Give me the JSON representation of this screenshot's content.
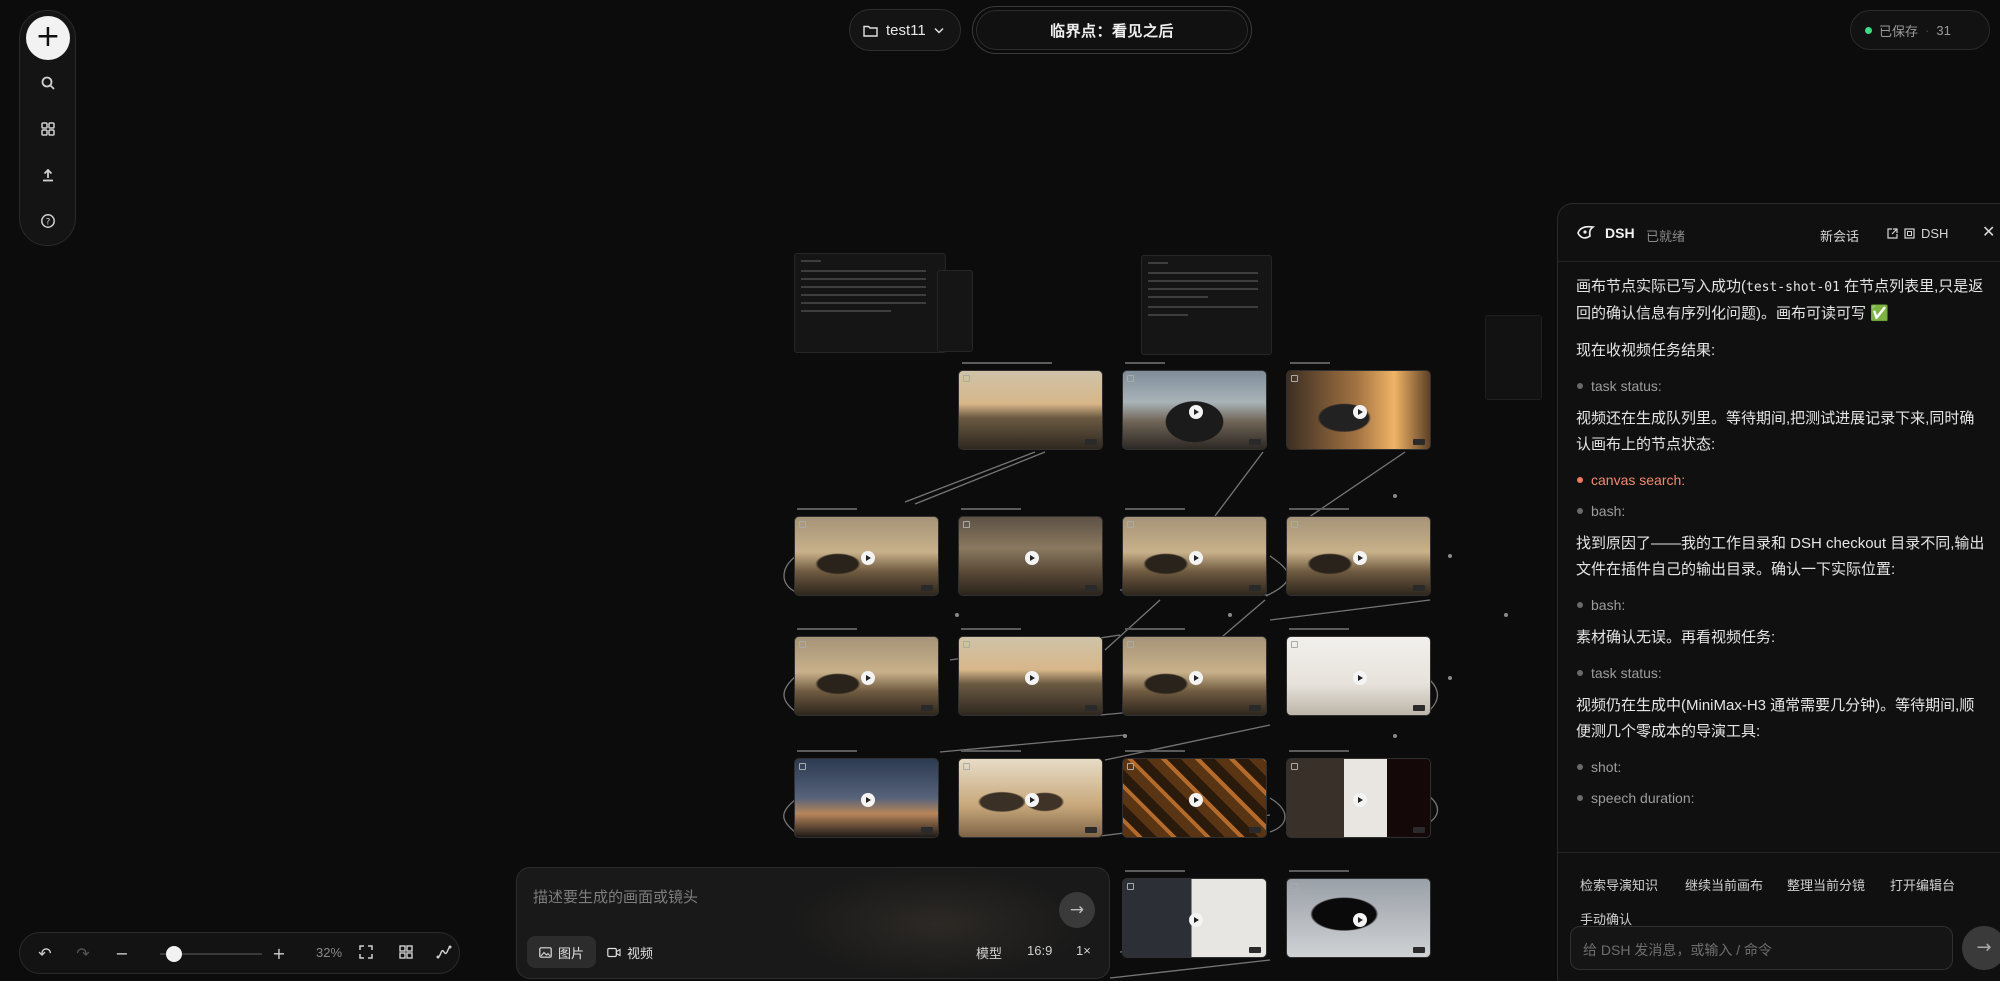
{
  "toolbar": {
    "add_icon": "plus-icon",
    "items": [
      "search-icon",
      "grid-icon",
      "upload-icon",
      "help-icon"
    ]
  },
  "project": {
    "name": "test11",
    "icon": "folder-icon"
  },
  "document_title": "临界点：看见之后",
  "save_status": {
    "label": "已保存",
    "count": "31",
    "color": "#3ddc84"
  },
  "zoom": {
    "level": "32%",
    "icons": [
      "undo-icon",
      "redo-icon",
      "zoom-out-icon",
      "zoom-in-icon",
      "fit-icon",
      "grid-toggle-icon",
      "link-icon"
    ]
  },
  "composer": {
    "placeholder": "描述要生成的画面或镜头",
    "mode_image": "图片",
    "mode_video": "视频",
    "model_label": "模型",
    "aspect": "16:9",
    "count": "1×"
  },
  "chat": {
    "brand": "DSH",
    "status": "已就绪",
    "new_chat": "新会话",
    "export": "DSH",
    "messages": [
      {
        "kind": "text",
        "before": "画布节点实际已写入成功(",
        "code": "test-shot-01",
        "after": " 在节点列表里,只是返回的确认信息有序列化问题)。画布可读可写 ✅"
      },
      {
        "kind": "text",
        "text": "现在收视频任务结果:"
      },
      {
        "kind": "tool",
        "text": "task status:"
      },
      {
        "kind": "text",
        "text": "视频还在生成队列里。等待期间,把测试进展记录下来,同时确认画布上的节点状态:"
      },
      {
        "kind": "tool-hot",
        "text": "canvas search:"
      },
      {
        "kind": "tool",
        "text": "bash:"
      },
      {
        "kind": "text",
        "text": "找到原因了——我的工作目录和 DSH checkout 目录不同,输出文件在插件自己的输出目录。确认一下实际位置:"
      },
      {
        "kind": "tool",
        "text": "bash:"
      },
      {
        "kind": "text",
        "text": "素材确认无误。再看视频任务:"
      },
      {
        "kind": "tool",
        "text": "task status:"
      },
      {
        "kind": "text",
        "text": "视频仍在生成中(MiniMax-H3 通常需要几分钟)。等待期间,顺便测几个零成本的导演工具:"
      },
      {
        "kind": "tool",
        "text": "shot:"
      },
      {
        "kind": "tool",
        "text": "speech duration:"
      }
    ],
    "quick_actions": [
      "检索导演知识",
      "继续当前画布",
      "整理当前分镜",
      "打开编辑台",
      "手动确认"
    ],
    "input_placeholder": "给 DSH 发消息，或输入 / 命令"
  }
}
